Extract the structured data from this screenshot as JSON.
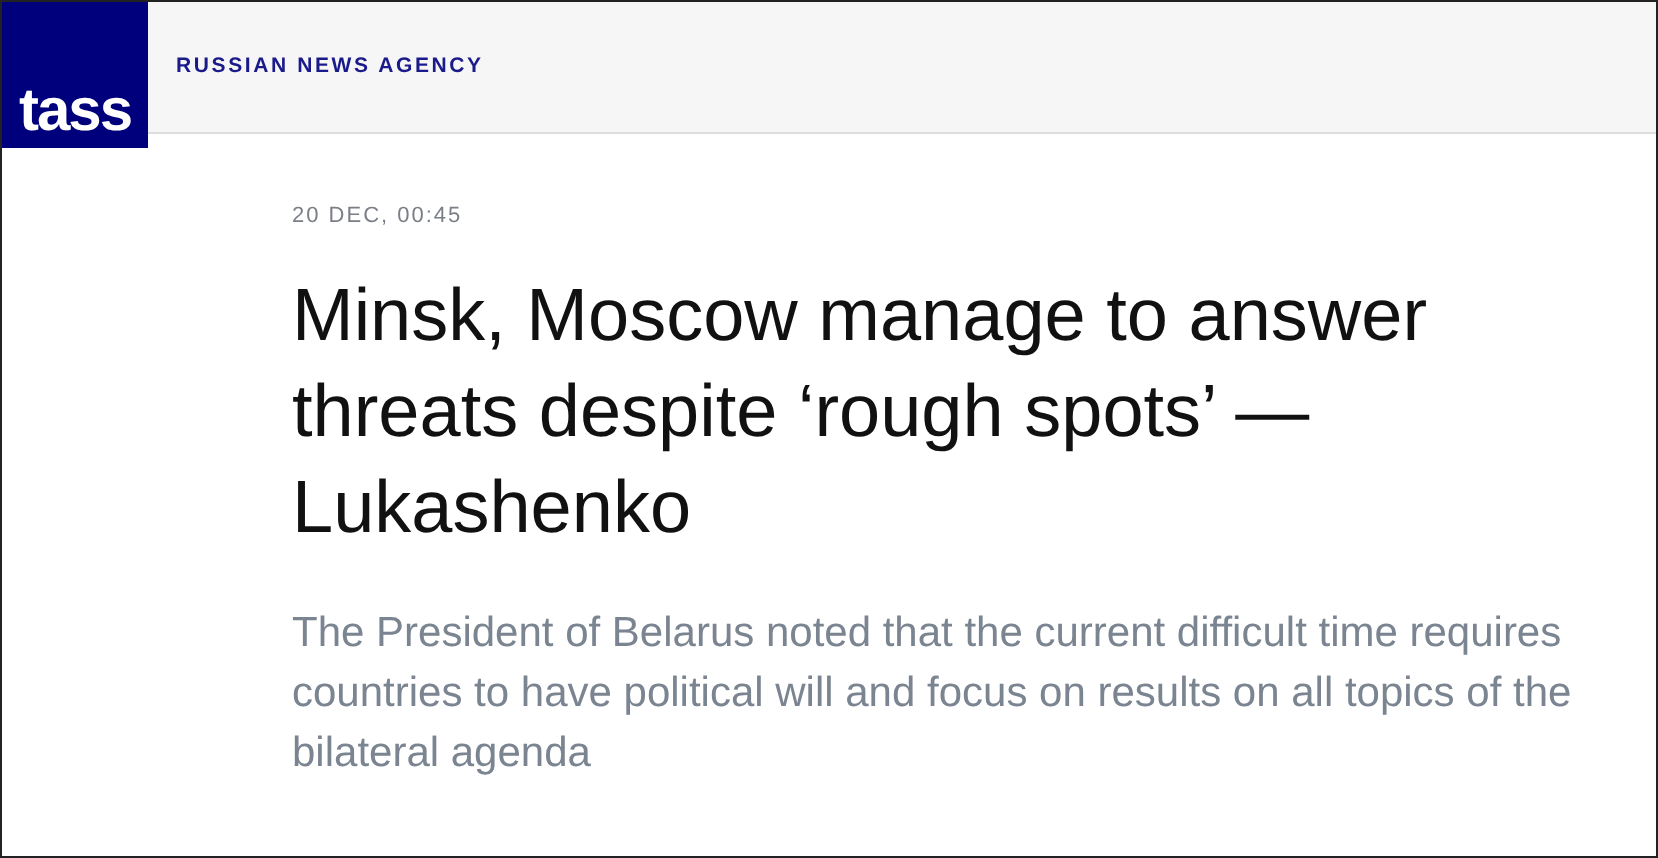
{
  "header": {
    "logo": "tass",
    "tagline": "RUSSIAN NEWS AGENCY"
  },
  "article": {
    "date": "20 DEC, 00:45",
    "headline": "Minsk, Moscow manage to answer threats despite ‘rough spots’ — Lukashenko",
    "lead": "The President of Belarus noted that the current difficult time requires countries to have political will and focus on results on all topics of the bilateral agenda"
  }
}
